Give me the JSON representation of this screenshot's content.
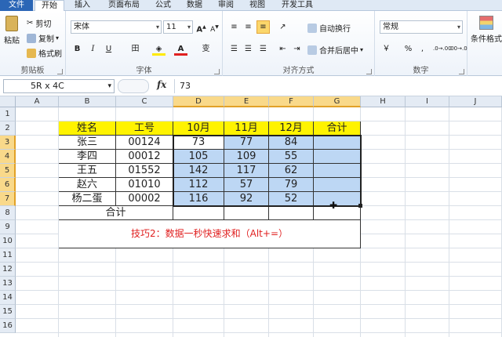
{
  "ribbon": {
    "tabs": [
      "文件",
      "开始",
      "插入",
      "页面布局",
      "公式",
      "数据",
      "审阅",
      "视图",
      "开发工具"
    ],
    "clipboard": {
      "paste": "粘贴",
      "cut": "剪切",
      "copy": "复制",
      "format_painter": "格式刷",
      "label": "剪贴板"
    },
    "font": {
      "name": "宋体",
      "size": "11",
      "grow": "A",
      "shrink": "A",
      "bold": "B",
      "italic": "I",
      "underline": "U",
      "border": "田",
      "fill": "◈",
      "color": "A",
      "phonetic": "变",
      "label": "字体"
    },
    "align": {
      "wrap": "自动换行",
      "merge": "合并后居中",
      "label": "对齐方式"
    },
    "number": {
      "format": "常规",
      "currency": "￥",
      "percent": "%",
      "comma": ",",
      "inc": ".0→.00",
      "dec": ".00→.0",
      "label": "数字"
    },
    "styles": {
      "cond": "条件格式"
    }
  },
  "formula_bar": {
    "name_box": "5R x 4C",
    "fx": "fx",
    "value": "73"
  },
  "columns": [
    "A",
    "B",
    "C",
    "D",
    "E",
    "F",
    "G",
    "H",
    "I",
    "J"
  ],
  "rows": [
    "1",
    "2",
    "3",
    "4",
    "5",
    "6",
    "7",
    "8",
    "9",
    "10",
    "11",
    "12",
    "13",
    "14",
    "15",
    "16"
  ],
  "table": {
    "headers": [
      "姓名",
      "工号",
      "10月",
      "11月",
      "12月",
      "合计"
    ],
    "data": [
      [
        "张三",
        "00124",
        "73",
        "77",
        "84",
        ""
      ],
      [
        "李四",
        "00012",
        "105",
        "109",
        "55",
        ""
      ],
      [
        "王五",
        "01552",
        "142",
        "117",
        "62",
        ""
      ],
      [
        "赵六",
        "01010",
        "112",
        "57",
        "79",
        ""
      ],
      [
        "杨二蛋",
        "00002",
        "116",
        "92",
        "52",
        ""
      ]
    ],
    "total_label": "合计",
    "tip": "技巧2：数据一秒快速求和（Alt+=）"
  },
  "colors": {
    "header_fill": "#fff300",
    "selection_fill": "#bdd7f4",
    "tip_text": "#e02020"
  }
}
